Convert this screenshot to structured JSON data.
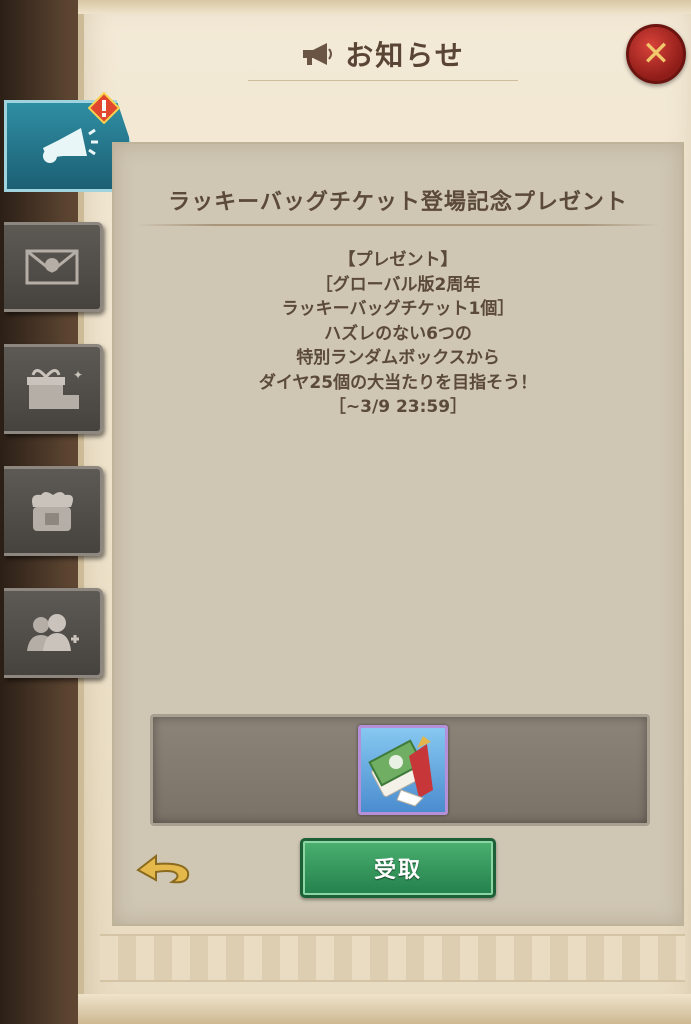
{
  "header": {
    "title": "お知らせ",
    "icon": "megaphone-icon"
  },
  "close_button": {
    "icon": "close-icon",
    "symbol": "✕"
  },
  "sidebar": {
    "tabs": [
      {
        "id": "notices",
        "icon": "megaphone-icon",
        "active": true,
        "alert": true
      },
      {
        "id": "mail",
        "icon": "envelope-icon",
        "active": false
      },
      {
        "id": "gifts",
        "icon": "gift-box-icon",
        "active": false
      },
      {
        "id": "rewards",
        "icon": "bundle-icon",
        "active": false
      },
      {
        "id": "friends",
        "icon": "friends-icon",
        "active": false
      }
    ]
  },
  "notice": {
    "title": "ラッキーバッグチケット登場記念プレゼント",
    "lines": [
      "【プレゼント】",
      "［グローバル版2周年",
      "ラッキーバッグチケット1個］",
      "ハズレのない6つの",
      "特別ランダムボックスから",
      "ダイヤ25個の大当たりを目指そう！",
      "［~3/9 23:59］"
    ]
  },
  "reward": {
    "icon": "lucky-bag-ticket-icon"
  },
  "receive_button": {
    "label": "受取"
  },
  "back_button": {
    "icon": "back-arrow-icon"
  },
  "colors": {
    "panel": "#cfc6b3",
    "text": "#5b4a3a",
    "button_green": "#2f9a5c",
    "active_tab": "#2f8ea3",
    "close_red": "#b52a24"
  }
}
